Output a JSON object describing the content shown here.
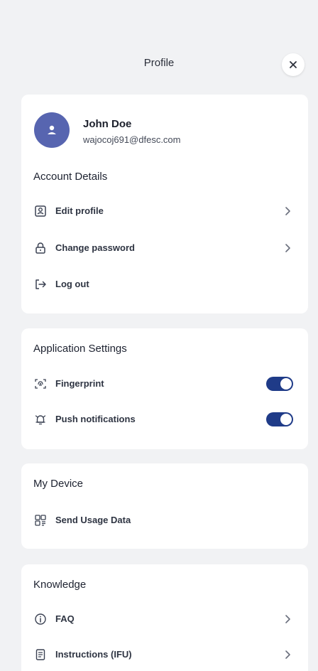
{
  "header": {
    "title": "Profile",
    "close_icon": "close-icon"
  },
  "user": {
    "name": "John Doe",
    "email": "wajocoj691@dfesc.com",
    "avatar_icon": "person-icon",
    "avatar_color": "#5765b0"
  },
  "account": {
    "title": "Account Details",
    "items": [
      {
        "label": "Edit profile",
        "icon": "profile-card-icon",
        "chevron": true
      },
      {
        "label": "Change password",
        "icon": "lock-icon",
        "chevron": true
      },
      {
        "label": "Log out",
        "icon": "logout-icon",
        "chevron": false
      }
    ]
  },
  "app_settings": {
    "title": "Application Settings",
    "items": [
      {
        "label": "Fingerprint",
        "icon": "fingerprint-icon",
        "toggle": true
      },
      {
        "label": "Push notifications",
        "icon": "bell-icon",
        "toggle": true
      }
    ]
  },
  "device": {
    "title": "My Device",
    "items": [
      {
        "label": "Send Usage Data",
        "icon": "usage-data-icon"
      }
    ]
  },
  "knowledge": {
    "title": "Knowledge",
    "items": [
      {
        "label": "FAQ",
        "icon": "info-icon",
        "chevron": true
      },
      {
        "label": "Instructions (IFU)",
        "icon": "document-icon",
        "chevron": true
      }
    ]
  },
  "colors": {
    "accent": "#1f3b88",
    "background": "#f1f2f4",
    "card": "#ffffff"
  }
}
